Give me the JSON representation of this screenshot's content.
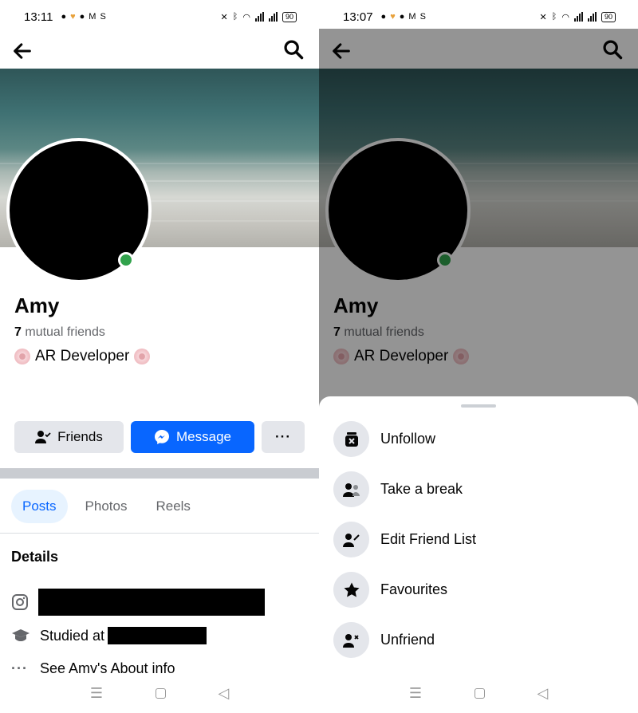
{
  "left": {
    "status": {
      "time": "13:11",
      "battery": "90"
    },
    "profile": {
      "name": "Amy",
      "mutual_count": "7",
      "mutual_label": "mutual friends",
      "bio": "AR Developer"
    },
    "actions": {
      "friends": "Friends",
      "message": "Message",
      "more": "···"
    },
    "tabs": [
      "Posts",
      "Photos",
      "Reels"
    ],
    "details": {
      "title": "Details",
      "studied_label": "Studied at",
      "about_label": "See Amy's About info"
    }
  },
  "right": {
    "status": {
      "time": "13:07",
      "battery": "90"
    },
    "profile": {
      "name": "Amy",
      "mutual_count": "7",
      "mutual_label": "mutual friends",
      "bio": "AR Developer"
    },
    "sheet": {
      "items": [
        {
          "label": "Unfollow",
          "icon": "unfollow-icon"
        },
        {
          "label": "Take a break",
          "icon": "take-break-icon"
        },
        {
          "label": "Edit Friend List",
          "icon": "edit-friend-list-icon"
        },
        {
          "label": "Favourites",
          "icon": "star-icon"
        },
        {
          "label": "Unfriend",
          "icon": "unfriend-icon"
        }
      ]
    }
  },
  "colors": {
    "accent": "#0866ff",
    "online": "#31a24c",
    "tab_active_bg": "#e7f3ff"
  }
}
